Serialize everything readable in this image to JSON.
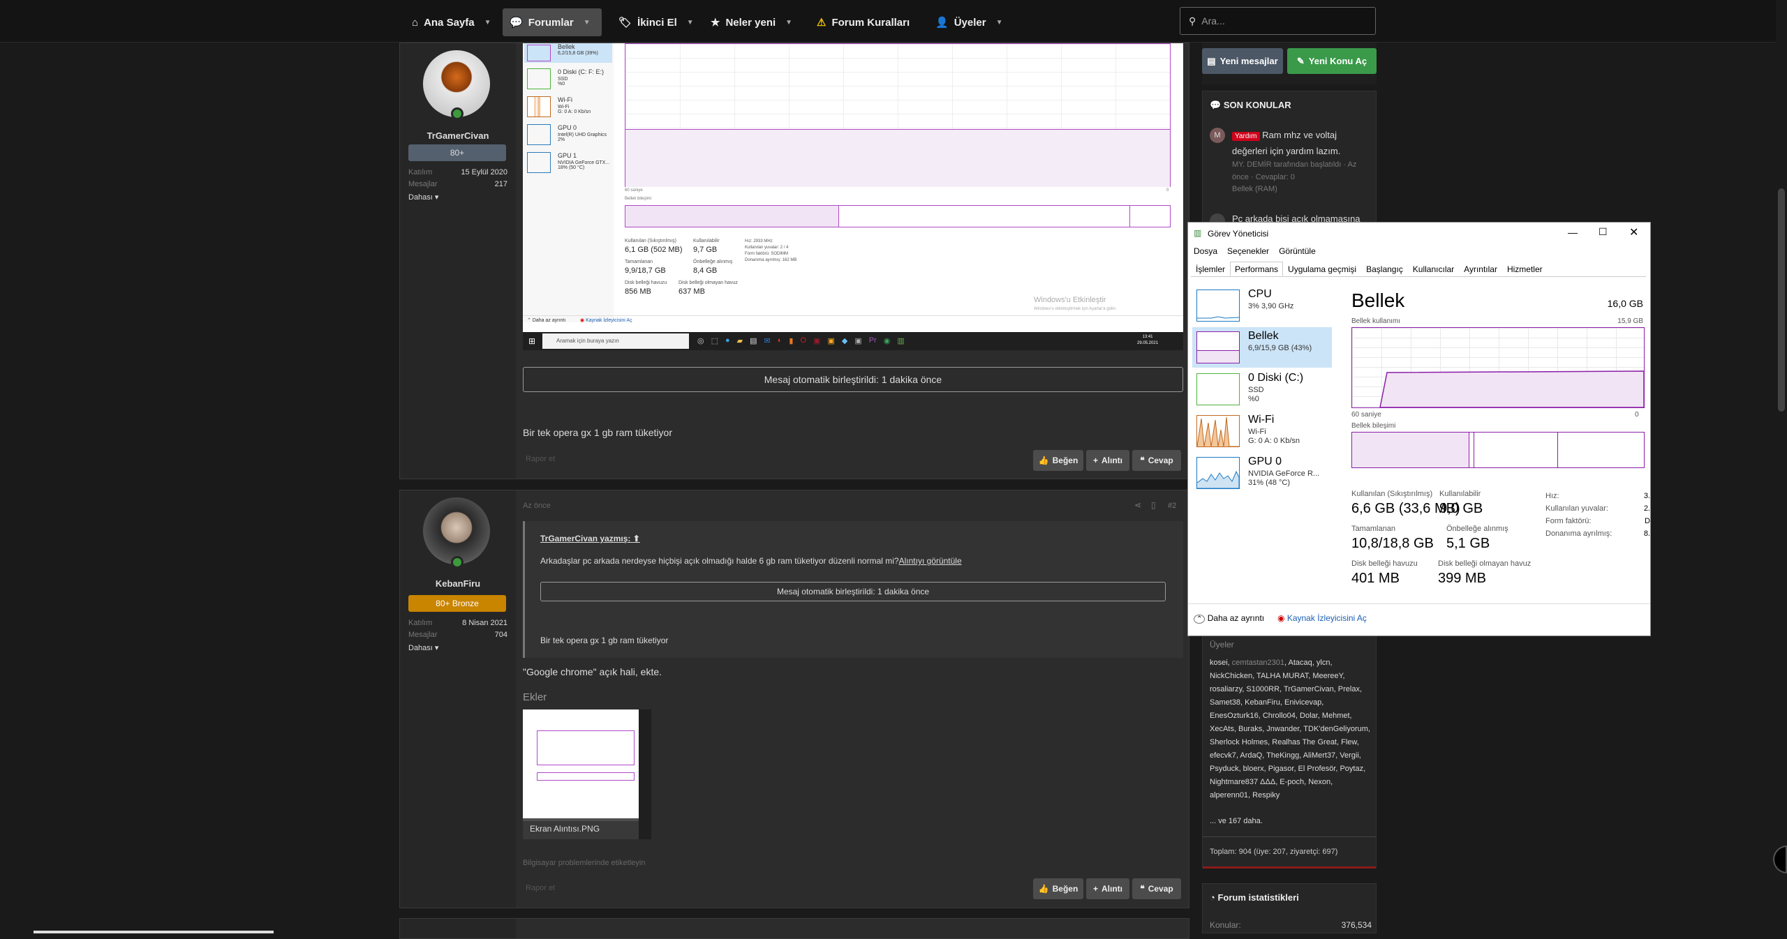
{
  "nav": {
    "items": [
      {
        "label": "Ana Sayfa",
        "icon": "home-icon"
      },
      {
        "label": "Forumlar",
        "icon": "comments-icon"
      },
      {
        "label": "İkinci El",
        "icon": "tag-icon"
      },
      {
        "label": "Neler yeni",
        "icon": "star-icon"
      },
      {
        "label": "Forum Kuralları",
        "icon": "warning-icon"
      },
      {
        "label": "Üyeler",
        "icon": "user-icon"
      }
    ],
    "search_placeholder": "Ara..."
  },
  "post1": {
    "username": "TrGamerCivan",
    "badge": "80+",
    "joined_label": "Katılım",
    "joined": "15 Eylül 2020",
    "messages_label": "Mesajlar",
    "messages": "217",
    "more": "Dahası",
    "merged_note": "Mesaj otomatik birleştirildi: 1 dakika önce",
    "body": "Bir tek opera gx 1 gb ram tüketiyor",
    "report": "Rapor et",
    "like": "Beğen",
    "quote": "Alıntı",
    "reply": "Cevap",
    "screenshot": {
      "list": [
        {
          "name": "Bellek",
          "sub": "6,2/15,8 GB (39%)"
        },
        {
          "name": "0 Diski (C: F: E:)",
          "sub": "SSD\n%0"
        },
        {
          "name": "Wi-Fi",
          "sub": "Wi-Fi\nG: 0 A: 0 Kb/sn"
        },
        {
          "name": "GPU 0",
          "sub": "Intel(R) UHD Graphics\n2%"
        },
        {
          "name": "GPU 1",
          "sub": "NVIDIA GeForce GTX...\n18% (50 °C)"
        }
      ],
      "axis_left": "60 saniye",
      "axis_right": "0",
      "composition": "Bellek bileşimi",
      "stats": [
        {
          "label": "Kullanılan (Sıkıştırılmış)",
          "value": "6,1 GB (502 MB)"
        },
        {
          "label": "Kullanılabilir",
          "value": "9,7 GB"
        },
        {
          "label": "Tamamlanan",
          "value": "9,9/18,7 GB"
        },
        {
          "label": "Önbelleğe alınmış",
          "value": "8,4 GB"
        },
        {
          "label": "Disk belleği havuzu",
          "value": "856 MB"
        },
        {
          "label": "Disk belleği olmayan havuz",
          "value": "637 MB"
        }
      ],
      "right_stats": [
        {
          "label": "Hız:",
          "value": "2933 MHz"
        },
        {
          "label": "Kullanılan yuvalar:",
          "value": "2 / 4"
        },
        {
          "label": "Form faktörü:",
          "value": "SODIMM"
        },
        {
          "label": "Donanıma ayrılmış:",
          "value": "162 MB"
        }
      ],
      "less_details": "Daha az ayrıntı",
      "resource_monitor": "Kaynak İzleyicisini Aç",
      "activate_title": "Windows'u Etkinleştir",
      "activate_sub": "Windows'u etkinleştirmek için Ayarlar'a gidin.",
      "taskbar_search": "Aramak için buraya yazın",
      "taskbar_time": "13:41",
      "taskbar_date": "29.05.2021"
    }
  },
  "post2": {
    "username": "KebanFiru",
    "badge": "80+ Bronze",
    "joined_label": "Katılım",
    "joined": "8 Nisan 2021",
    "messages_label": "Mesajlar",
    "messages": "704",
    "more": "Dahası",
    "time": "Az önce",
    "post_num": "#2",
    "quote_author": "TrGamerCivan yazmış:",
    "quote_text": "Arkadaşlar pc arkada nerdeyse hiçbişi açık olmadığı halde 6 gb ram tüketiyor düzenli normal mi?",
    "quote_link": "Alıntıyı görüntüle",
    "quote_merged": "Mesaj otomatik birleştirildi: 1 dakika önce",
    "quote_body": "Bir tek opera gx 1 gb ram tüketiyor",
    "body": "\"Google chrome\" açık hali, ekte.",
    "attachments_label": "Ekler",
    "attachment_name": "Ekran Alıntısı.PNG",
    "tag_note": "Bilgisayar problemlerinde etiketleyin",
    "report": "Rapor et",
    "like": "Beğen",
    "quote": "Alıntı",
    "reply": "Cevap"
  },
  "sidebar": {
    "new_messages": "Yeni mesajlar",
    "new_topic": "Yeni Konu Aç",
    "recent_title": "SON KONULAR",
    "recent": [
      {
        "avatar": "M",
        "tag": "Yardım",
        "title": "Ram mhz ve voltaj değerleri için yardım lazım.",
        "meta": "MY. DEMİR tarafından başlatıldı · Az önce · Cevaplar: 0",
        "forum": "Bellek (RAM)"
      },
      {
        "avatar": "",
        "tag": "",
        "title": "Pc arkada bişi açık olmamasına",
        "meta": "",
        "forum": ""
      }
    ],
    "members_label": "Üyeler",
    "members_text_before": "kosei, ",
    "members_text_dim": "cemtastan2301",
    "members_text_after": ", Atacaq, ylcn, NickChicken, TALHA MURAT, MeereeY, rosaliarzy, S1000RR, TrGamerCivan, Prelax, Samet38, KebanFiru, Enivicevap, EnesOzturk16, Chrollo04, Dolar, Mehmet, XecAts, Buraks, Jnwander, TDK'denGeliyorum, Sherlock Holmes, Realhas The Great, Flew, efecvk7, ArdaQ, TheKingg, AliMert37, Vergii, Psyduck, bloerx, Pigasor, El Profesör, Poytaz, Nightmare837 ΔΔΔ, E-poch, Nexon, alperenn01, Respiky",
    "members_more": "... ve 167 daha.",
    "total": "Toplam: 904 (üye: 207, ziyaretçi: 697)",
    "stats_title": "Forum istatistikleri",
    "topics_label": "Konular:",
    "topics_value": "376,534"
  },
  "taskmanager": {
    "title": "Görev Yöneticisi",
    "menu": [
      "Dosya",
      "Seçenekler",
      "Görüntüle"
    ],
    "tabs": [
      "İşlemler",
      "Performans",
      "Uygulama geçmişi",
      "Başlangıç",
      "Kullanıcılar",
      "Ayrıntılar",
      "Hizmetler"
    ],
    "resources": [
      {
        "name": "CPU",
        "sub": "3% 3,90 GHz"
      },
      {
        "name": "Bellek",
        "sub": "6,9/15,9 GB (43%)"
      },
      {
        "name": "0 Diski (C:)",
        "sub": "SSD\n%0"
      },
      {
        "name": "Wi-Fi",
        "sub": "Wi-Fi\nG: 0 A: 0 Kb/sn"
      },
      {
        "name": "GPU 0",
        "sub": "NVIDIA GeForce R...\n31% (48 °C)"
      }
    ],
    "heading": "Bellek",
    "capacity": "16,0 GB",
    "usage_label": "Bellek kullanımı",
    "usage_max": "15,9 GB",
    "axis_left": "60 saniye",
    "axis_right": "0",
    "composition": "Bellek bileşimi",
    "stats": [
      {
        "label": "Kullanılan (Sıkıştırılmış)",
        "value": "6,6 GB (33,6 MB)"
      },
      {
        "label": "Kullanılabilir",
        "value": "9,0 GB"
      },
      {
        "label": "Tamamlanan",
        "value": "10,8/18,8 GB"
      },
      {
        "label": "Önbelleğe alınmış",
        "value": "5,1 GB"
      },
      {
        "label": "Disk belleği havuzu",
        "value": "401 MB"
      },
      {
        "label": "Disk belleği olmayan havuz",
        "value": "399 MB"
      }
    ],
    "right_labels": [
      {
        "label": "Hız:",
        "value": "3."
      },
      {
        "label": "Kullanılan yuvalar:",
        "value": "2."
      },
      {
        "label": "Form faktörü:",
        "value": "D"
      },
      {
        "label": "Donanıma ayrılmış:",
        "value": "8."
      }
    ],
    "less_details": "Daha az ayrıntı",
    "resource_monitor": "Kaynak İzleyicisini Aç"
  }
}
